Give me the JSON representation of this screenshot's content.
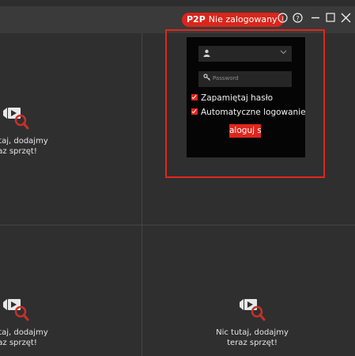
{
  "titlebar": {
    "p2p_label": "P2P",
    "status": "Nie zalogowany",
    "info_icon": "info-icon",
    "help_icon": "help-icon",
    "minimize_icon": "minimize-icon",
    "maximize_icon": "maximize-icon",
    "close_icon": "close-icon"
  },
  "login": {
    "user_icon": "user-icon",
    "username_value": "",
    "password_placeholder": "Password",
    "remember_label": "Zapamiętaj hasło",
    "remember_checked": true,
    "autologin_label": "Automatyczne logowanie",
    "autologin_checked": true,
    "login_button": "aloguj s"
  },
  "panes": [
    {
      "line1": "c tutaj, dodajmy",
      "line2": "raz sprzęt!"
    },
    {
      "line1": "c tutaj, dodajmy",
      "line2": "raz sprzęt!"
    },
    {
      "line1": "Nic tutaj, dodajmy",
      "line2": "teraz sprzęt!"
    }
  ],
  "colors": {
    "accent": "#e0261c",
    "background": "#2f2f2f",
    "titlebar": "#3a3a3a"
  }
}
